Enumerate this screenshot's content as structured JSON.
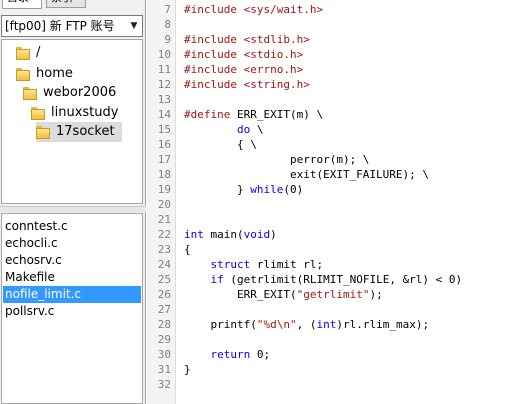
{
  "tabs": [
    "目录",
    "索引"
  ],
  "site_select": {
    "value": "[ftp00] 新 FTP 账号"
  },
  "tree": [
    "/",
    "home",
    "webor2006",
    "linuxstudy",
    "17socket"
  ],
  "files": [
    "conntest.c",
    "echocli.c",
    "echosrv.c",
    "Makefile",
    "nofile_limit.c",
    "pollsrv.c"
  ],
  "selected_file": "nofile_limit.c",
  "colors": {
    "preprocessor": "#a31515",
    "keyword": "#0000ff",
    "string": "#a31515",
    "selection": "#3399ff"
  },
  "editor": {
    "line_numbers": [
      "7",
      "8",
      "9",
      "10",
      "11",
      "12",
      "13",
      "14",
      "15",
      "16",
      "17",
      "18",
      "19",
      "20",
      "21",
      "22",
      "23",
      "24",
      "25",
      "26",
      "27",
      "28",
      "29",
      "30",
      "31",
      "32"
    ],
    "lines": [
      [
        {
          "t": "#include <sys/wait.h>",
          "c": "pre"
        }
      ],
      [],
      [
        {
          "t": "#include <stdlib.h>",
          "c": "pre"
        }
      ],
      [
        {
          "t": "#include <stdio.h>",
          "c": "pre"
        }
      ],
      [
        {
          "t": "#include <errno.h>",
          "c": "pre"
        }
      ],
      [
        {
          "t": "#include <string.h>",
          "c": "pre"
        }
      ],
      [],
      [
        {
          "t": "#define ",
          "c": "pre"
        },
        {
          "t": "ERR_EXIT(m) \\"
        }
      ],
      [
        {
          "t": "        "
        },
        {
          "t": "do",
          "c": "kw"
        },
        {
          "t": " \\"
        }
      ],
      [
        {
          "t": "        { \\"
        }
      ],
      [
        {
          "t": "                perror(m); \\"
        }
      ],
      [
        {
          "t": "                exit(EXIT_FAILURE); \\"
        }
      ],
      [
        {
          "t": "        } "
        },
        {
          "t": "while",
          "c": "kw"
        },
        {
          "t": "(0)"
        }
      ],
      [],
      [],
      [
        {
          "t": "int",
          "c": "kw"
        },
        {
          "t": " main("
        },
        {
          "t": "void",
          "c": "kw"
        },
        {
          "t": ")"
        }
      ],
      [
        {
          "t": "{"
        }
      ],
      [
        {
          "t": "    "
        },
        {
          "t": "struct",
          "c": "kw"
        },
        {
          "t": " rlimit rl;"
        }
      ],
      [
        {
          "t": "    "
        },
        {
          "t": "if",
          "c": "kw"
        },
        {
          "t": " (getrlimit(RLIMIT_NOFILE, &rl) < 0)"
        }
      ],
      [
        {
          "t": "        ERR_EXIT("
        },
        {
          "t": "\"getrlimit\"",
          "c": "str"
        },
        {
          "t": ");"
        }
      ],
      [],
      [
        {
          "t": "    printf("
        },
        {
          "t": "\"%d\\n\"",
          "c": "str"
        },
        {
          "t": ", ("
        },
        {
          "t": "int",
          "c": "kw"
        },
        {
          "t": ")rl.rlim_max);"
        }
      ],
      [],
      [
        {
          "t": "    "
        },
        {
          "t": "return",
          "c": "kw"
        },
        {
          "t": " 0;"
        }
      ],
      [
        {
          "t": "}"
        }
      ],
      []
    ]
  }
}
